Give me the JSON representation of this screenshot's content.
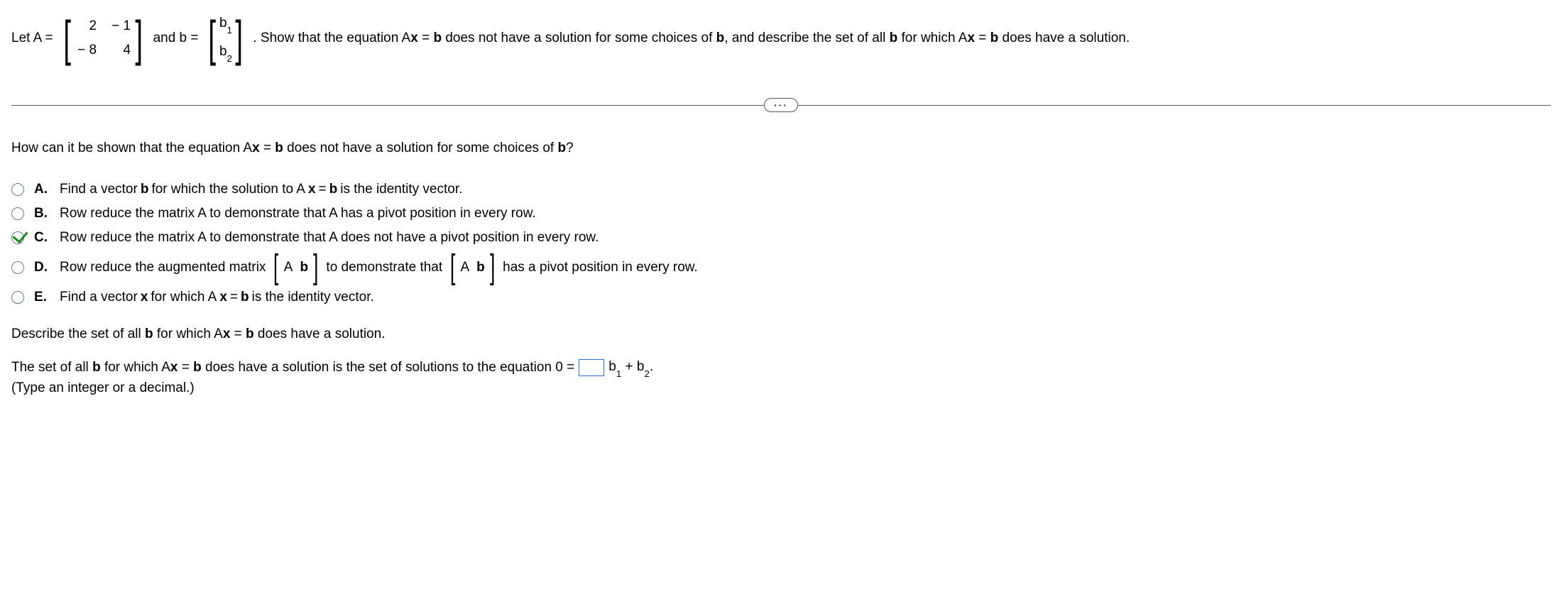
{
  "problem": {
    "let_A_eq": "Let A =",
    "matrix_A": [
      [
        "2",
        "− 1"
      ],
      [
        "− 8",
        "4"
      ]
    ],
    "and_b_eq": " and b =",
    "vector_b": [
      "b₁",
      "b₂"
    ],
    "after_text": ". Show that the equation Ax = b does not have a solution for some choices of b, and describe the set of all b for which Ax = b does have a solution."
  },
  "ellipsis": "···",
  "question": "How can it be shown that the equation Ax = b does not have a solution for some choices of b?",
  "options": {
    "A": {
      "label": "A.",
      "text": "Find a vector b for which the solution to Ax = b is the identity vector.",
      "checked": false
    },
    "B": {
      "label": "B.",
      "text": "Row reduce the matrix A to demonstrate that A has a pivot position in every row.",
      "checked": false
    },
    "C": {
      "label": "C.",
      "text": "Row reduce the matrix A to demonstrate that A does not have a pivot position in every row.",
      "checked": true
    },
    "D": {
      "label": "D.",
      "pre": "Row reduce the augmented matrix",
      "aug1": [
        "A",
        "b"
      ],
      "mid": "to demonstrate that",
      "aug2": [
        "A",
        "b"
      ],
      "post": "has a pivot position in every row.",
      "checked": false
    },
    "E": {
      "label": "E.",
      "text": "Find a vector x for which Ax = b is the identity vector.",
      "checked": false
    }
  },
  "describe_heading": "Describe the set of all b for which Ax = b does have a solution.",
  "answer": {
    "pre": "The set of all b for which Ax = b does have a solution is the set of solutions to the equation 0 =",
    "post_expr": "b₁ + b₂.",
    "hint": "(Type an integer or a decimal.)"
  }
}
